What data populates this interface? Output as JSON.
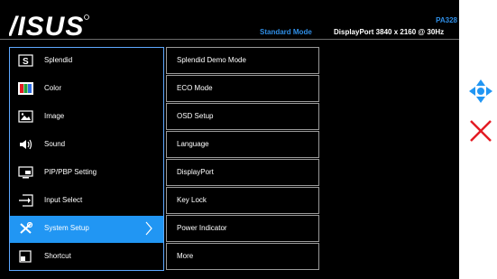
{
  "header": {
    "brand": "ASUS",
    "model": "PA328",
    "mode": "Standard Mode",
    "status": "DisplayPort  3840 x 2160 @ 30Hz"
  },
  "menu": [
    {
      "label": "Splendid",
      "icon": "splendid-icon"
    },
    {
      "label": "Color",
      "icon": "color-icon"
    },
    {
      "label": "Image",
      "icon": "image-icon"
    },
    {
      "label": "Sound",
      "icon": "speaker-icon"
    },
    {
      "label": "PIP/PBP Setting",
      "icon": "pip-icon"
    },
    {
      "label": "Input Select",
      "icon": "input-select-icon"
    },
    {
      "label": "System Setup",
      "icon": "tools-icon",
      "selected": true
    },
    {
      "label": "Shortcut",
      "icon": "shortcut-icon"
    }
  ],
  "submenu": [
    "Splendid Demo Mode",
    "ECO Mode",
    "OSD Setup",
    "Language",
    "DisplayPort",
    "Key Lock",
    "Power Indicator",
    "More"
  ],
  "side_buttons": [
    {
      "icon": "navigation-joystick-icon"
    },
    {
      "icon": "close-icon"
    }
  ],
  "colors": {
    "accent": "#2196f3",
    "brand_blue": "#2f8ee6",
    "close_red": "#e31b23"
  }
}
